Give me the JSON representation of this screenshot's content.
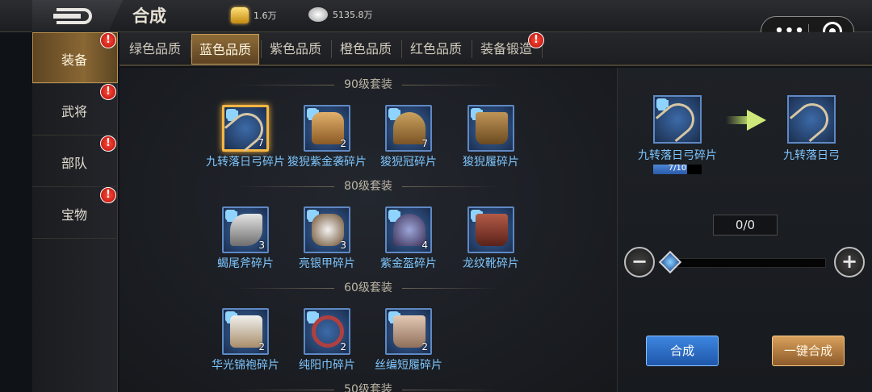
{
  "header": {
    "title": "合成",
    "gold_amount": "1.6万",
    "silver_amount": "5135.8万"
  },
  "miniprogram": {
    "more": "•••"
  },
  "sidebar": {
    "items": [
      {
        "label": "装备",
        "active": true,
        "alert": "!"
      },
      {
        "label": "武将",
        "active": false,
        "alert": "!"
      },
      {
        "label": "部队",
        "active": false,
        "alert": "!"
      },
      {
        "label": "宝物",
        "active": false,
        "alert": "!"
      }
    ]
  },
  "tabs": [
    {
      "label": "绿色品质",
      "active": false
    },
    {
      "label": "蓝色品质",
      "active": true
    },
    {
      "label": "紫色品质",
      "active": false
    },
    {
      "label": "橙色品质",
      "active": false
    },
    {
      "label": "红色品质",
      "active": false
    },
    {
      "label": "装备锻造",
      "active": false,
      "alert": "!"
    }
  ],
  "sections": [
    {
      "title": "90级套装",
      "items": [
        {
          "name": "九转落日弓碎片",
          "count": "7",
          "icon": "bow-icon",
          "selected": true
        },
        {
          "name": "狻猊紫金袭碎片",
          "count": "2",
          "icon": "armor-icon"
        },
        {
          "name": "狻猊冠碎片",
          "count": "7",
          "icon": "helmet-icon"
        },
        {
          "name": "狻猊履碎片",
          "count": "",
          "icon": "boots-icon"
        }
      ]
    },
    {
      "title": "80级套装",
      "items": [
        {
          "name": "蝎尾斧碎片",
          "count": "3",
          "icon": "axe-icon"
        },
        {
          "name": "亮银甲碎片",
          "count": "3",
          "icon": "armor-icon"
        },
        {
          "name": "紫金盔碎片",
          "count": "4",
          "icon": "helmet-icon"
        },
        {
          "name": "龙纹靴碎片",
          "count": "",
          "icon": "boots-icon"
        }
      ]
    },
    {
      "title": "60级套装",
      "items": [
        {
          "name": "华光锦袍碎片",
          "count": "2",
          "icon": "robe-icon"
        },
        {
          "name": "纯阳巾碎片",
          "count": "2",
          "icon": "scarf-icon"
        },
        {
          "name": "丝编短履碎片",
          "count": "2",
          "icon": "shoes-icon"
        }
      ]
    },
    {
      "title": "50级套装",
      "items": []
    }
  ],
  "panel": {
    "source_name": "九转落日弓碎片",
    "progress_text": "7/10",
    "progress": 0.7,
    "result_name": "九转落日弓",
    "quantity": "0/0",
    "minus": "−",
    "plus": "+",
    "craft_button": "合成",
    "craft_all_button": "一键合成"
  }
}
